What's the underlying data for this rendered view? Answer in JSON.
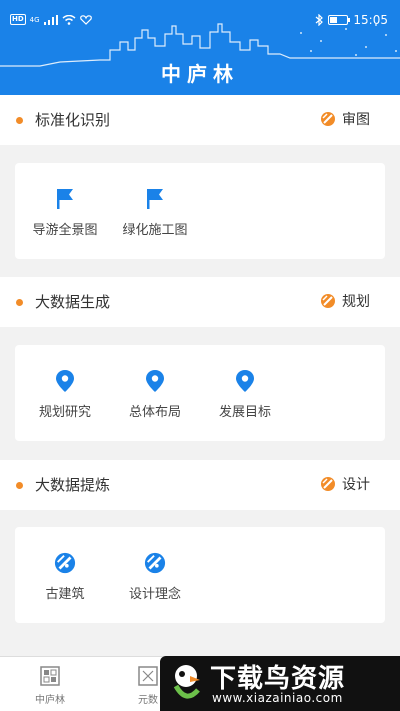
{
  "status_bar": {
    "hd": "HD",
    "network": "4G",
    "time": "15:05",
    "battery_level": 0.45
  },
  "app": {
    "title": "中庐林"
  },
  "sections": [
    {
      "title": "标准化识别",
      "action": "审图",
      "items": [
        {
          "label": "导游全景图",
          "icon": "flag-icon"
        },
        {
          "label": "绿化施工图",
          "icon": "flag-icon"
        }
      ]
    },
    {
      "title": "大数据生成",
      "action": "规划",
      "items": [
        {
          "label": "规划研究",
          "icon": "location-pin-icon"
        },
        {
          "label": "总体布局",
          "icon": "location-pin-icon"
        },
        {
          "label": "发展目标",
          "icon": "location-pin-icon"
        }
      ]
    },
    {
      "title": "大数据提炼",
      "action": "设计",
      "items": [
        {
          "label": "古建筑",
          "icon": "compass-icon"
        },
        {
          "label": "设计理念",
          "icon": "compass-icon"
        }
      ]
    }
  ],
  "bottom_nav": [
    {
      "label": "中庐林",
      "icon": "home-grid-icon"
    },
    {
      "label": "元数",
      "icon": "network-icon"
    }
  ],
  "watermark": {
    "text": "下载鸟资源",
    "url": "www.xiazainiao.com"
  },
  "colors": {
    "primary": "#1a82e8",
    "accent": "#f28c28"
  }
}
